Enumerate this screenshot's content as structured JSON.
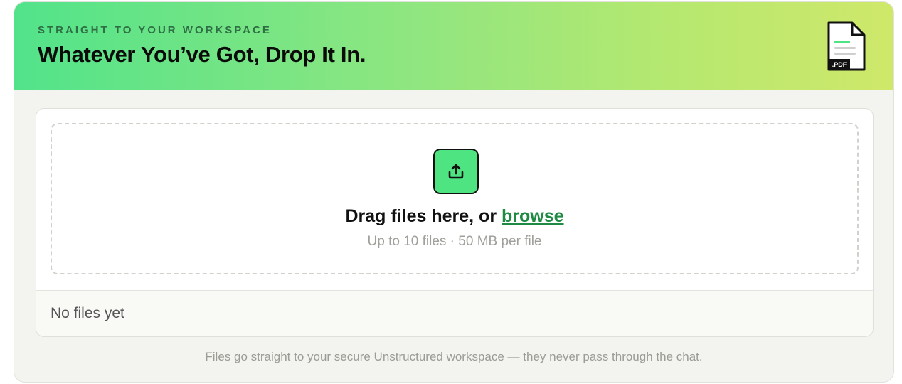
{
  "header": {
    "eyebrow": "STRAIGHT TO YOUR WORKSPACE",
    "title": "Whatever You’ve Got, Drop It In.",
    "doc_icon": "pdf-document-icon",
    "doc_icon_label": ".PDF"
  },
  "dropzone": {
    "upload_icon": "upload-icon",
    "prompt_prefix": "Drag files here, or ",
    "browse_label": "browse",
    "limits": "Up to 10 files · 50 MB per file"
  },
  "file_list": {
    "empty_text": "No files yet"
  },
  "footer": {
    "note": "Files go straight to your secure Unstructured workspace — they never pass through the chat."
  },
  "colors": {
    "accent_green": "#4ee482",
    "link_green": "#1f8a43",
    "header_gradient_start": "#52e38a",
    "header_gradient_end": "#cfe86a"
  }
}
